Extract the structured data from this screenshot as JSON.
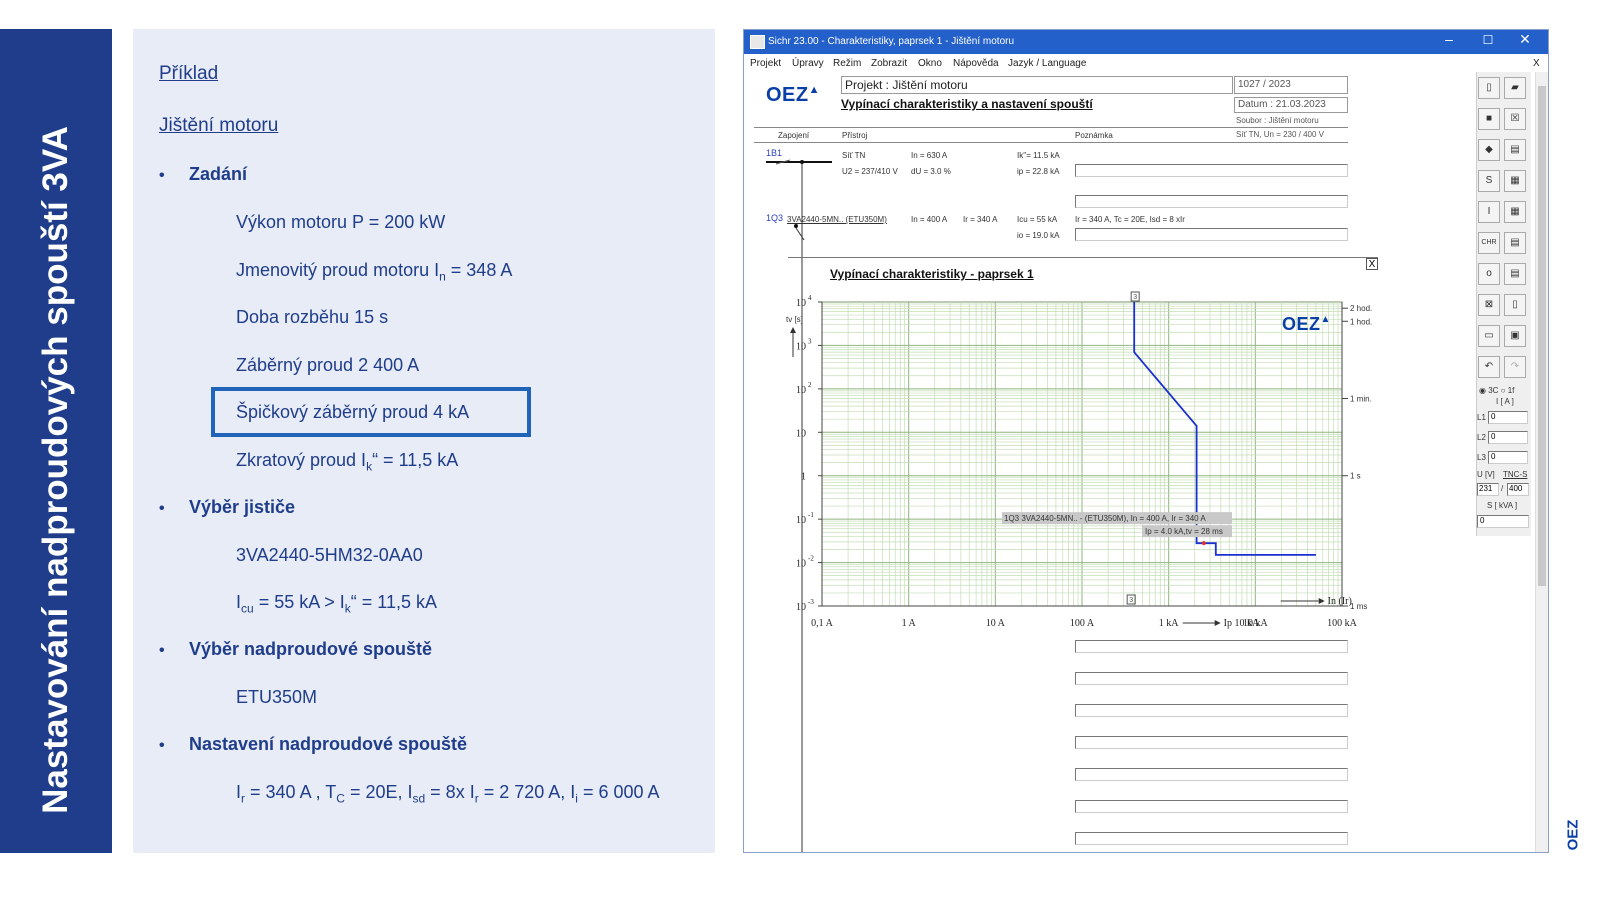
{
  "slide": {
    "side_title": "Nastavování nadproudových spouští 3VA",
    "link1": "Příklad",
    "link2": "Jištění motoru",
    "sections": {
      "zadani": "Zadání",
      "vyber_jistice": "Výběr jističe",
      "vyber_spoustе": "Výběr nadproudové spouště",
      "nastaveni": "Nastavení nadproudové spouště"
    },
    "items": {
      "vykon": "Výkon motoru P = 200 kW",
      "jmen_a": "Jmenovitý proud motoru I",
      "jmen_sub": "n",
      "jmen_b": " = 348 A",
      "doba": "Doba rozběhu 15 s",
      "zaberny": "Záběrný proud 2 400 A",
      "spickovy": "Špičkový záběrný proud 4 kA",
      "zkrat_a": "Zkratový proud I",
      "zkrat_sub": "k",
      "zkrat_b": "“ = 11,5 kA",
      "jistic": "3VA2440-5HM32-0AA0",
      "icu_a": "I",
      "icu_sub": "cu",
      "icu_b": " = 55 kA > I",
      "icu_sub2": "k",
      "icu_c": "“ = 11,5 kA",
      "etu": "ETU350M",
      "set_1": "I",
      "set_1s": "r",
      "set_2": " = 340 A , T",
      "set_2s": "C",
      "set_3": " = 20E, I",
      "set_3s": "sd",
      "set_4": " = 8x I",
      "set_4s": "r",
      "set_5": " = 2 720 A, I",
      "set_5s": "i",
      "set_6": " = 6 000 A"
    }
  },
  "app": {
    "title": "Sichr 23.00 - Charakteristiky, paprsek 1 - Jištění motoru",
    "menu": [
      "Projekt",
      "Úpravy",
      "Režim",
      "Zobrazit",
      "Okno",
      "Nápověda",
      "Jazyk / Language"
    ],
    "menu_close": "X",
    "logo": "OEZ",
    "project_label": "Projekt : Jištění motoru",
    "subtitle": "Vypínací charakteristiky a nastavení spouští",
    "number": "1027 / 2023",
    "date": "Datum : 21.03.2023",
    "file": "Soubor : Jištění motoru",
    "net_info": "Síť TN, Un = 230 / 400 V",
    "col_zapojeni": "Zapojení",
    "col_pristroj": "Přístroj",
    "col_poznamka": "Poznámka",
    "row1": {
      "id": "1B1",
      "a": "Síť TN",
      "b": "In = 630 A",
      "c": "Ik''= 11.5 kA",
      "d": "U2 = 237/410 V",
      "e": "dU = 3.0 %",
      "f": "ip = 22.8 kA"
    },
    "row2": {
      "id": "1Q3",
      "a": "3VA2440-5MN.. (ETU350M)",
      "b": "In = 400 A",
      "c": "Ir = 340 A",
      "d": "Icu = 55 kA",
      "e": "Ir = 340 A, Tc = 20E, Isd = 8 xIr",
      "f": "io = 19.0 kA"
    },
    "panel_title": "Vypínací charakteristiky - paprsek 1",
    "panel_close": "X",
    "phase": {
      "opt1": "3",
      "opt2": "1f",
      "unit": "I [ A ]",
      "l1": "L1",
      "l2": "L2",
      "l3": "L3",
      "v1": "0",
      "v2": "0",
      "v3": "0",
      "u_label": "U [V]",
      "tnc": "TNC-S",
      "u1": "231",
      "slash": "/",
      "u2": "400",
      "s_label": "S [ kVA ]",
      "s_val": "0"
    }
  },
  "chart_data": {
    "type": "line",
    "title": "Vypínací charakteristiky - paprsek 1",
    "xlabel": "In (Ir)",
    "ylabel": "tv [s]",
    "x_scale": "log",
    "y_scale": "log",
    "xlim": [
      0.1,
      100000
    ],
    "ylim": [
      0.001,
      10000
    ],
    "x_ticks": [
      "0,1 A",
      "1 A",
      "10 A",
      "100 A",
      "1 kA",
      "10 kA",
      "100 kA"
    ],
    "x_tick_values": [
      0.1,
      1,
      10,
      100,
      1000,
      10000,
      100000
    ],
    "y_ticks": [
      {
        "v": 10000,
        "base": "10",
        "exp": "4"
      },
      {
        "v": 1000,
        "base": "10",
        "exp": "3"
      },
      {
        "v": 100,
        "base": "10",
        "exp": "2"
      },
      {
        "v": 10,
        "base": "10",
        "exp": ""
      },
      {
        "v": 1,
        "base": "1",
        "exp": ""
      },
      {
        "v": 0.1,
        "base": "10",
        "exp": "-1"
      },
      {
        "v": 0.01,
        "base": "10",
        "exp": "-2"
      },
      {
        "v": 0.001,
        "base": "10",
        "exp": "-3"
      }
    ],
    "right_labels": [
      {
        "v": 7200,
        "text": "2 hod."
      },
      {
        "v": 3600,
        "text": "1 hod."
      },
      {
        "v": 60,
        "text": "1 min."
      },
      {
        "v": 1,
        "text": "1 s"
      },
      {
        "v": 0.001,
        "text": "1 ms"
      }
    ],
    "ip_label": "Ip 10 kA",
    "grid": true,
    "series": [
      {
        "name": "1Q3",
        "color": "#1a2fd0",
        "points": [
          [
            400,
            10000
          ],
          [
            400,
            700
          ],
          [
            2100,
            14
          ],
          [
            2100,
            0.028
          ],
          [
            3500,
            0.028
          ],
          [
            3500,
            0.015
          ],
          [
            50000,
            0.015
          ]
        ]
      }
    ],
    "tooltip": [
      "1Q3 3VA2440-5MN.. - (ETU350M), In = 400 A, Ir = 340 A",
      "Ip = 4.0 kA,tv = 28 ms"
    ],
    "markers": {
      "top": "3",
      "bottom": "3"
    }
  }
}
